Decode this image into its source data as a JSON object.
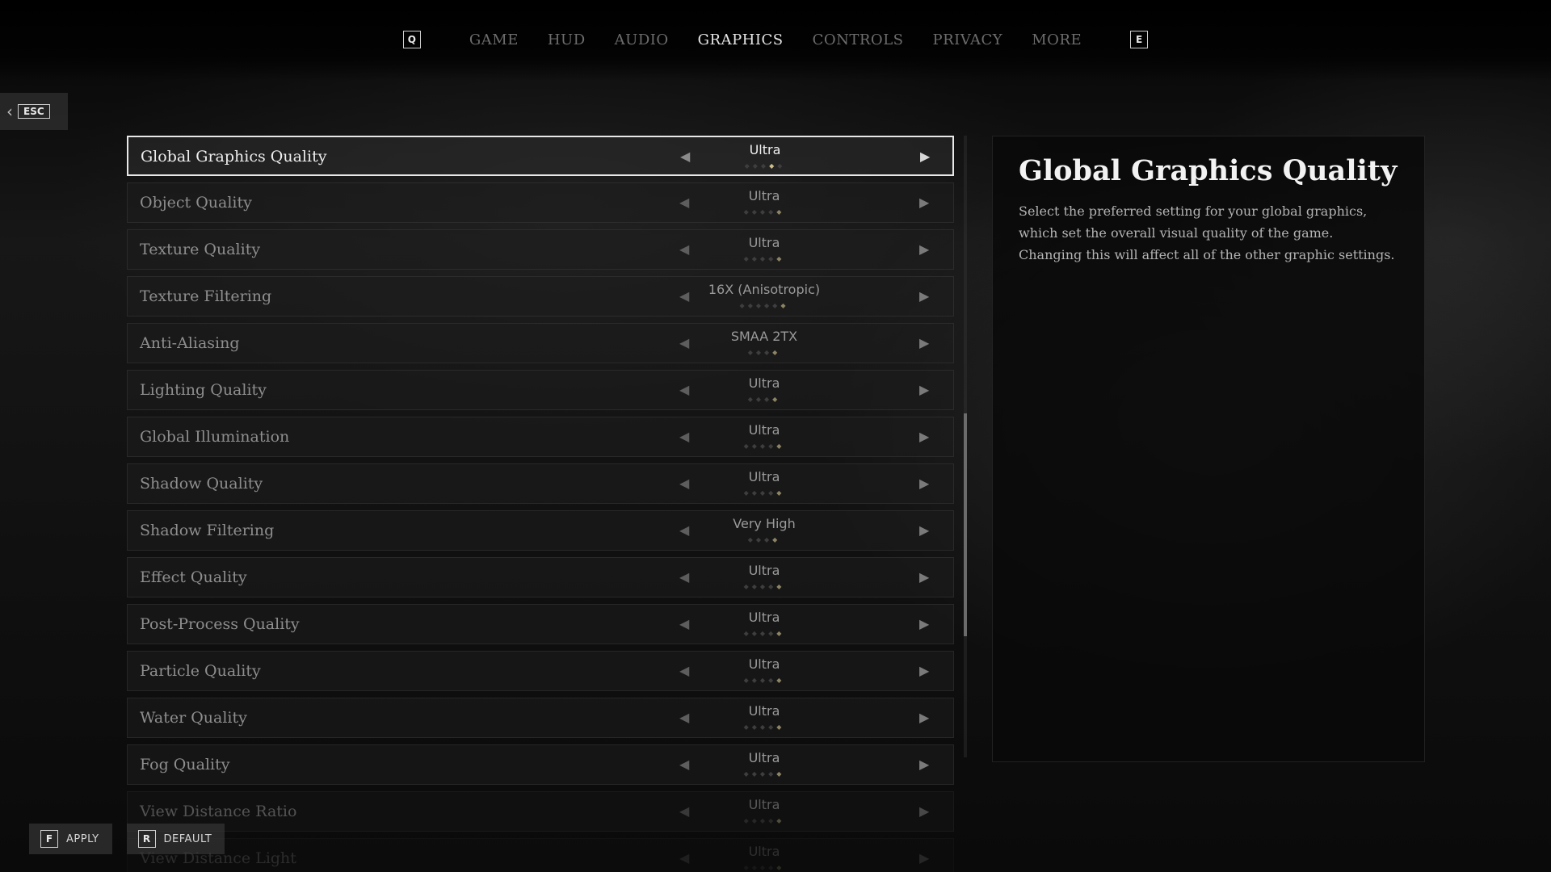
{
  "nav": {
    "prev_key": "Q",
    "next_key": "E",
    "tabs": [
      {
        "label": "GAME"
      },
      {
        "label": "HUD"
      },
      {
        "label": "AUDIO"
      },
      {
        "label": "GRAPHICS"
      },
      {
        "label": "CONTROLS"
      },
      {
        "label": "PRIVACY"
      },
      {
        "label": "MORE"
      }
    ],
    "active_tab": "GRAPHICS"
  },
  "back": {
    "key": "ESC"
  },
  "settings": [
    {
      "label": "Global Graphics Quality",
      "value": "Ultra",
      "level": 4,
      "levels": 5
    },
    {
      "label": "Object Quality",
      "value": "Ultra",
      "level": 5,
      "levels": 5
    },
    {
      "label": "Texture Quality",
      "value": "Ultra",
      "level": 5,
      "levels": 5
    },
    {
      "label": "Texture Filtering",
      "value": "16X (Anisotropic)",
      "level": 6,
      "levels": 6
    },
    {
      "label": "Anti-Aliasing",
      "value": "SMAA 2TX",
      "level": 4,
      "levels": 4
    },
    {
      "label": "Lighting Quality",
      "value": "Ultra",
      "level": 4,
      "levels": 4
    },
    {
      "label": "Global Illumination",
      "value": "Ultra",
      "level": 5,
      "levels": 5
    },
    {
      "label": "Shadow Quality",
      "value": "Ultra",
      "level": 5,
      "levels": 5
    },
    {
      "label": "Shadow Filtering",
      "value": "Very High",
      "level": 4,
      "levels": 4
    },
    {
      "label": "Effect Quality",
      "value": "Ultra",
      "level": 5,
      "levels": 5
    },
    {
      "label": "Post-Process Quality",
      "value": "Ultra",
      "level": 5,
      "levels": 5
    },
    {
      "label": "Particle Quality",
      "value": "Ultra",
      "level": 5,
      "levels": 5
    },
    {
      "label": "Water Quality",
      "value": "Ultra",
      "level": 5,
      "levels": 5
    },
    {
      "label": "Fog Quality",
      "value": "Ultra",
      "level": 5,
      "levels": 5
    },
    {
      "label": "View Distance Ratio",
      "value": "Ultra",
      "level": 5,
      "levels": 5
    },
    {
      "label": "View Distance Light",
      "value": "Ultra",
      "level": 5,
      "levels": 5
    }
  ],
  "selected_index": 0,
  "description": {
    "title": "Global Graphics Quality",
    "text": "Select the preferred setting for your global graphics, which set the overall visual quality of the game. Changing this will affect all of the other graphic settings."
  },
  "actions": {
    "apply": {
      "key": "F",
      "label": "APPLY"
    },
    "default": {
      "key": "R",
      "label": "DEFAULT"
    }
  },
  "colors": {
    "accent_dot": "#cdbf8a",
    "selected_border": "#e8e8e8"
  },
  "icons": {
    "left_arrow": "arrow-left-icon",
    "right_arrow": "arrow-right-icon",
    "back_chevron": "chevron-left-icon"
  }
}
